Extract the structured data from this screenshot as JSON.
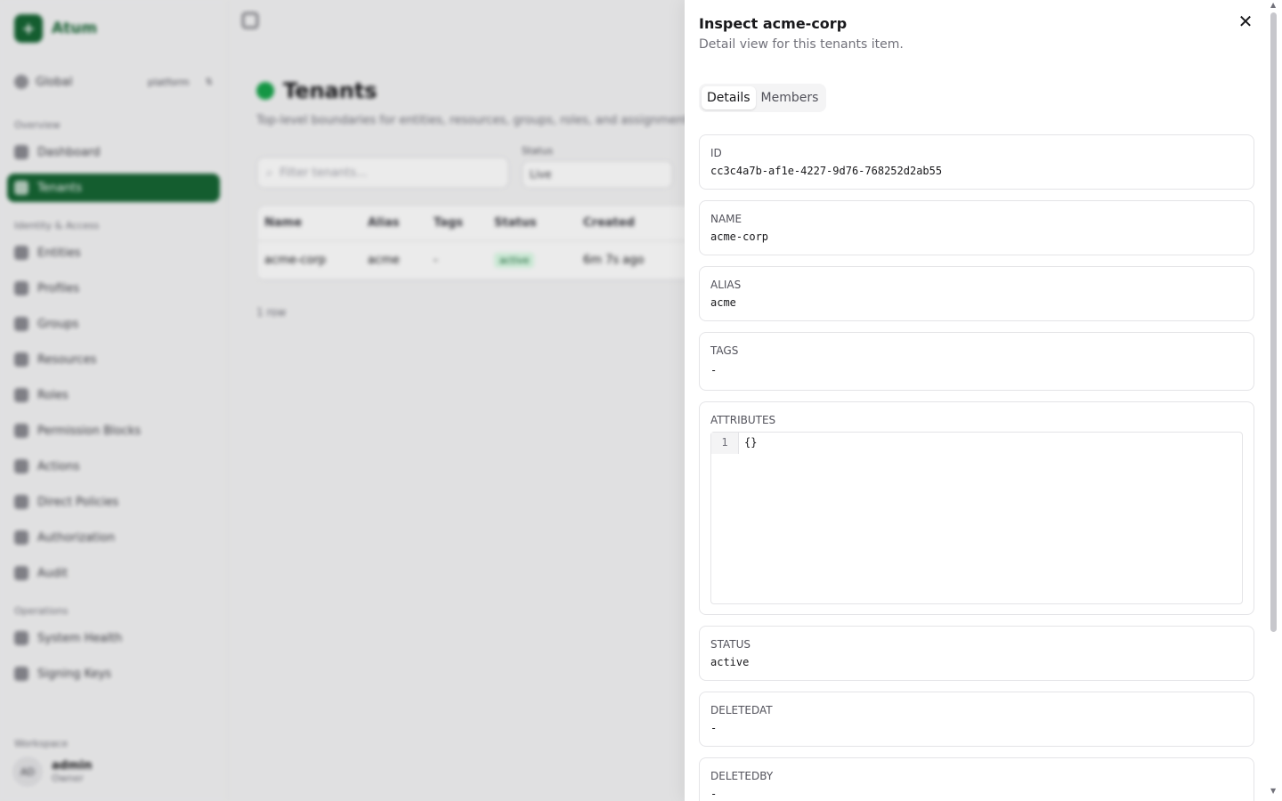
{
  "app": {
    "name": "Atum",
    "logo_glyph": "+"
  },
  "sidebar": {
    "scope_label": "Global",
    "scope_env": "platform",
    "sections": [
      {
        "title": "Overview",
        "items": [
          {
            "label": "Dashboard",
            "icon": "dashboard-icon",
            "active": false
          },
          {
            "label": "Tenants",
            "icon": "tenants-icon",
            "active": true
          }
        ]
      },
      {
        "title": "Identity & Access",
        "items": [
          {
            "label": "Entities",
            "icon": "entities-icon",
            "active": false
          },
          {
            "label": "Profiles",
            "icon": "profiles-icon",
            "active": false
          },
          {
            "label": "Groups",
            "icon": "groups-icon",
            "active": false
          },
          {
            "label": "Resources",
            "icon": "resources-icon",
            "active": false
          },
          {
            "label": "Roles",
            "icon": "roles-icon",
            "active": false
          },
          {
            "label": "Permission Blocks",
            "icon": "permission-blocks-icon",
            "active": false
          },
          {
            "label": "Actions",
            "icon": "actions-icon",
            "active": false
          },
          {
            "label": "Direct Policies",
            "icon": "direct-policies-icon",
            "active": false
          },
          {
            "label": "Authorization",
            "icon": "authorization-icon",
            "active": false
          },
          {
            "label": "Audit",
            "icon": "audit-icon",
            "active": false
          }
        ]
      },
      {
        "title": "Operations",
        "items": [
          {
            "label": "System Health",
            "icon": "system-health-icon",
            "active": false
          },
          {
            "label": "Signing Keys",
            "icon": "signing-keys-icon",
            "active": false
          }
        ]
      }
    ],
    "workspace_label": "Workspace",
    "user": {
      "initials": "AD",
      "name": "admin",
      "role": "Owner"
    }
  },
  "main": {
    "title": "Tenants",
    "subtitle": "Top-level boundaries for entities, resources, groups, roles, and assignments.",
    "search_placeholder": "Filter tenants...",
    "status_filter_label": "Status",
    "status_filter_value": "Live",
    "table": {
      "headers": [
        "Name",
        "Alias",
        "Tags",
        "Status",
        "Created"
      ],
      "rows": [
        [
          "acme-corp",
          "acme",
          "-",
          "active",
          "6m 7s ago"
        ]
      ]
    },
    "row_count": "1 row"
  },
  "drawer": {
    "title": "Inspect acme-corp",
    "subtitle": "Detail view for this tenants item.",
    "close_glyph": "✕",
    "tabs": [
      "Details",
      "Members"
    ],
    "active_tab": "Details",
    "fields": {
      "id": {
        "label": "ID",
        "value": "cc3c4a7b-af1e-4227-9d76-768252d2ab55"
      },
      "name": {
        "label": "NAME",
        "value": "acme-corp"
      },
      "alias": {
        "label": "ALIAS",
        "value": "acme"
      },
      "tags": {
        "label": "TAGS",
        "value": "-"
      },
      "attributes": {
        "label": "ATTRIBUTES",
        "line_number": "1",
        "code": "{}"
      },
      "status": {
        "label": "STATUS",
        "value": "active"
      },
      "deletedat": {
        "label": "DELETEDAT",
        "value": "-"
      },
      "deletedby": {
        "label": "DELETEDBY",
        "value": "-"
      }
    }
  },
  "colors": {
    "brand": "#166534",
    "accent": "#16a34a",
    "border": "#e4e4e7",
    "muted_text": "#71717a"
  }
}
